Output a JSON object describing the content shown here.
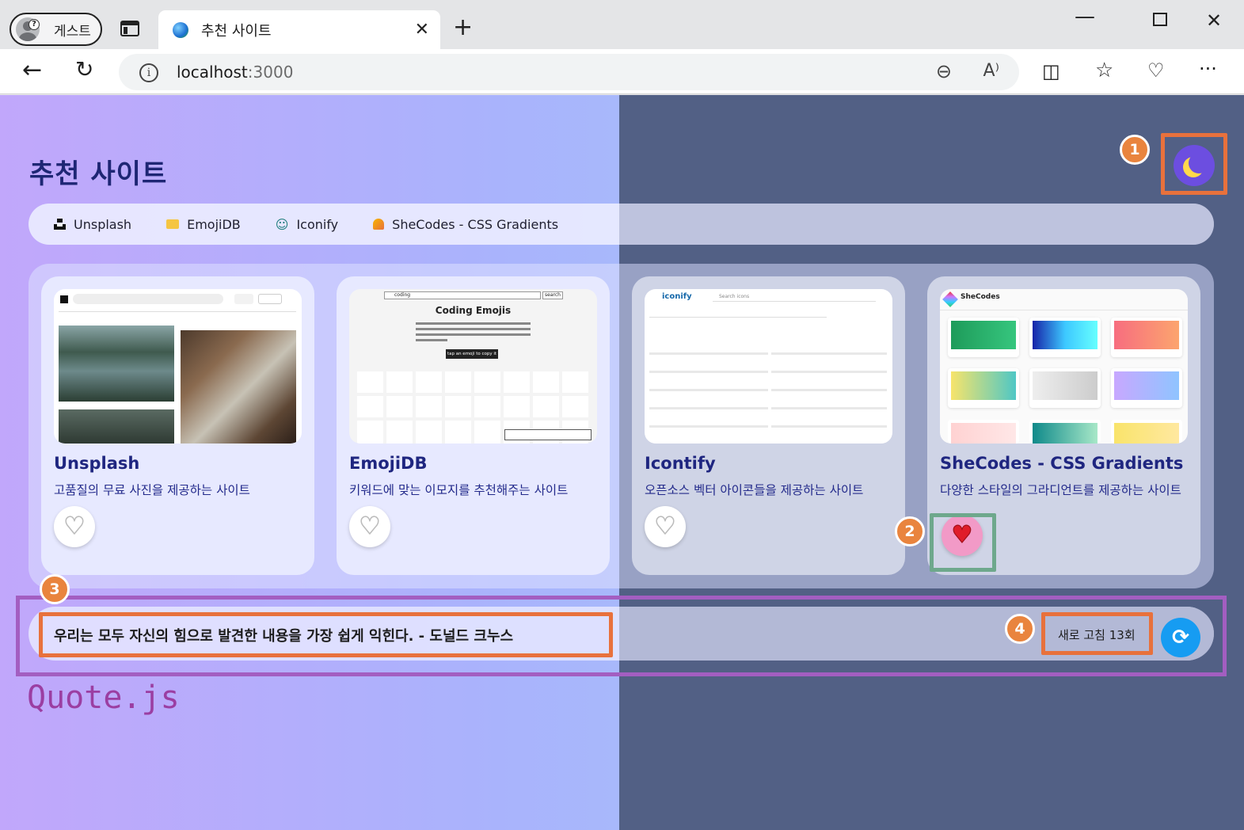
{
  "browser": {
    "profile_label": "게스트",
    "tab_title": "추천 사이트",
    "url_host": "localhost",
    "url_port": ":3000"
  },
  "page": {
    "title": "추천 사이트",
    "file_label": "Quote.js"
  },
  "nav_links": [
    {
      "label": "Unsplash",
      "icon": "unsplash-logo-icon"
    },
    {
      "label": "EmojiDB",
      "icon": "folder-icon"
    },
    {
      "label": "Iconify",
      "icon": "smiley-icon"
    },
    {
      "label": "SheCodes - CSS Gradients",
      "icon": "shecodes-logo-icon"
    }
  ],
  "cards": [
    {
      "name": "Unsplash",
      "desc": "고품질의 무료 사진을 제공하는 사이트",
      "liked": false
    },
    {
      "name": "EmojiDB",
      "desc": "키워드에 맞는 이모지를 추천해주는 사이트",
      "liked": false,
      "shot": {
        "search": "coding",
        "btn": "search",
        "heading": "Coding Emojis",
        "tap": "tap an emoji to copy it"
      }
    },
    {
      "name": "Icontify",
      "desc": "오픈소스 벡터 아이콘들을 제공하는 사이트",
      "liked": false,
      "shot": {
        "logo": "iconify",
        "search": "Search icons"
      }
    },
    {
      "name": "SheCodes - CSS Gradients",
      "desc": "다양한 스타일의 그라디언트를 제공하는 사이트",
      "liked": true,
      "shot": {
        "logo": "SheCodes"
      }
    }
  ],
  "quote": {
    "text": "우리는 모두 자신의 힘으로 발견한 내용을 가장 쉽게 익힌다. - 도널드 크누스",
    "refresh_count": "새로 고침 13회"
  },
  "annotations": [
    "1",
    "2",
    "3",
    "4"
  ],
  "colors": {
    "annotation_orange": "#e8713c",
    "annotation_purple": "#a35ec1",
    "heart_red": "#e01c2a",
    "refresh_blue": "#169cf2"
  }
}
